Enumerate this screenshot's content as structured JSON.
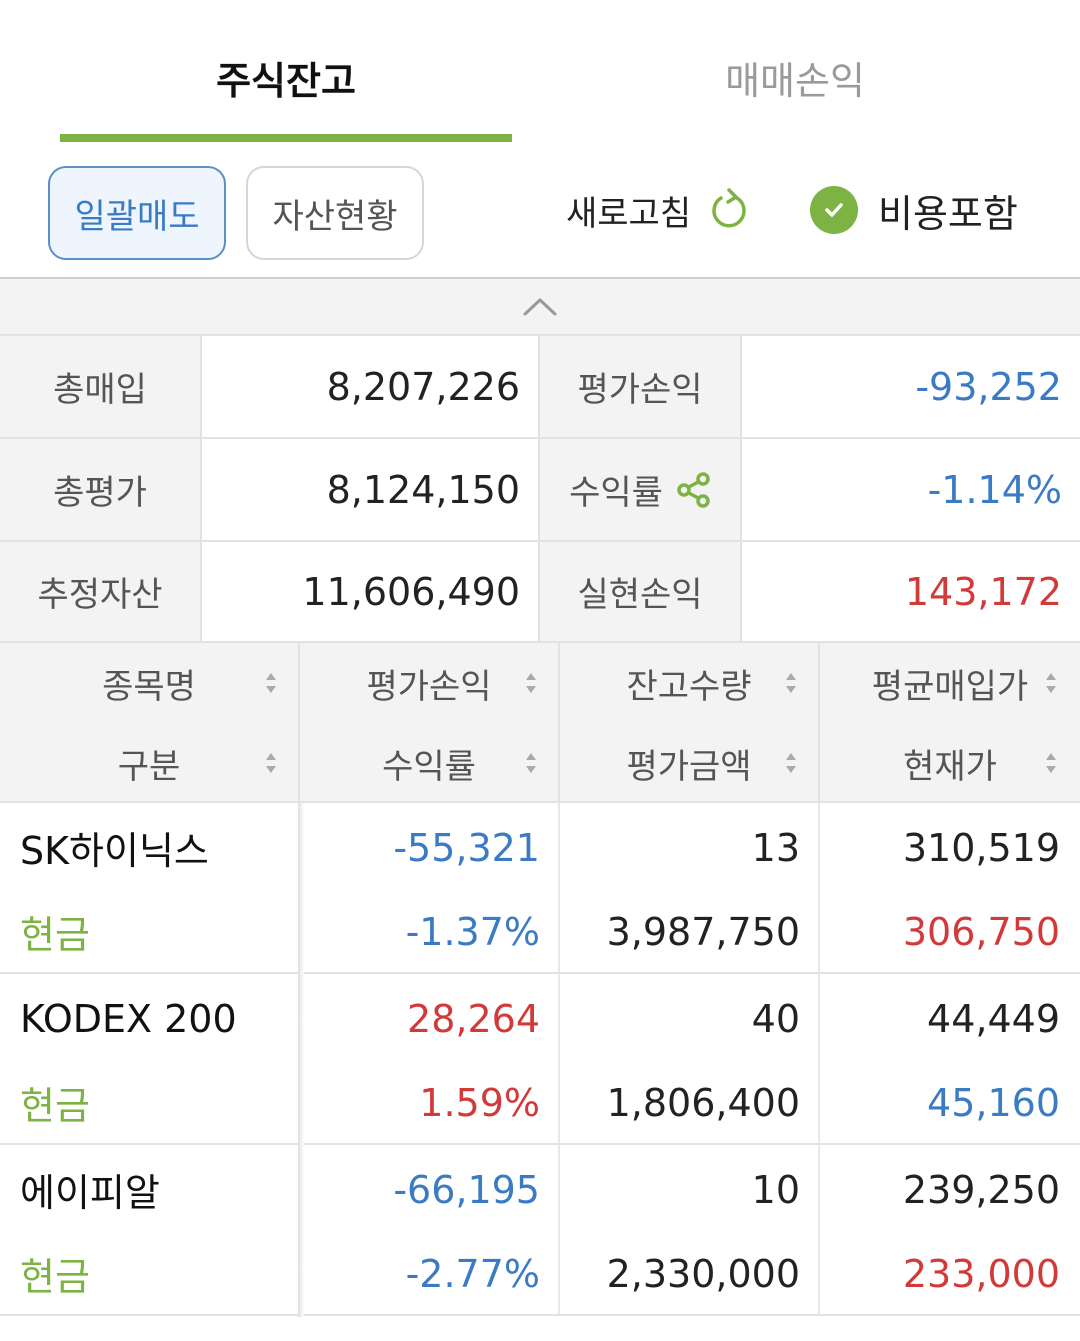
{
  "tabs": [
    {
      "label": "주식잔고",
      "active": true
    },
    {
      "label": "매매손익",
      "active": false
    }
  ],
  "toolbar": {
    "bulk_sell_label": "일괄매도",
    "asset_status_label": "자산현황",
    "refresh_label": "새로고침",
    "refresh_icon": "refresh-icon",
    "include_fee_label": "비용포함",
    "include_fee_checked": true
  },
  "summary": {
    "total_purchase_label": "총매입",
    "total_purchase": "8,207,226",
    "eval_pl_label": "평가손익",
    "eval_pl": "-93,252",
    "total_eval_label": "총평가",
    "total_eval": "8,124,150",
    "return_rate_label": "수익률",
    "return_rate": "-1.14%",
    "est_assets_label": "추정자산",
    "est_assets": "11,606,490",
    "realized_pl_label": "실현손익",
    "realized_pl": "143,172"
  },
  "table": {
    "headers": {
      "c1_top": "종목명",
      "c1_bottom": "구분",
      "c2_top": "평가손익",
      "c2_bottom": "수익률",
      "c3_top": "잔고수량",
      "c3_bottom": "평가금액",
      "c4_top": "평균매입가",
      "c4_bottom": "현재가"
    },
    "rows": [
      {
        "name": "SK하이닉스",
        "category": "현금",
        "eval_pl": "-55,321",
        "return_rate": "-1.37%",
        "quantity": "13",
        "eval_amount": "3,987,750",
        "avg_price": "310,519",
        "current_price": "306,750"
      },
      {
        "name": "KODEX 200",
        "category": "현금",
        "eval_pl": "28,264",
        "return_rate": "1.59%",
        "quantity": "40",
        "eval_amount": "1,806,400",
        "avg_price": "44,449",
        "current_price": "45,160"
      },
      {
        "name": "에이피알",
        "category": "현금",
        "eval_pl": "-66,195",
        "return_rate": "-2.77%",
        "quantity": "10",
        "eval_amount": "2,330,000",
        "avg_price": "239,250",
        "current_price": "233,000"
      }
    ]
  },
  "colors": {
    "accent_green": "#7cb342",
    "negative_blue": "#3b7bc4",
    "positive_red": "#d23a3a"
  }
}
